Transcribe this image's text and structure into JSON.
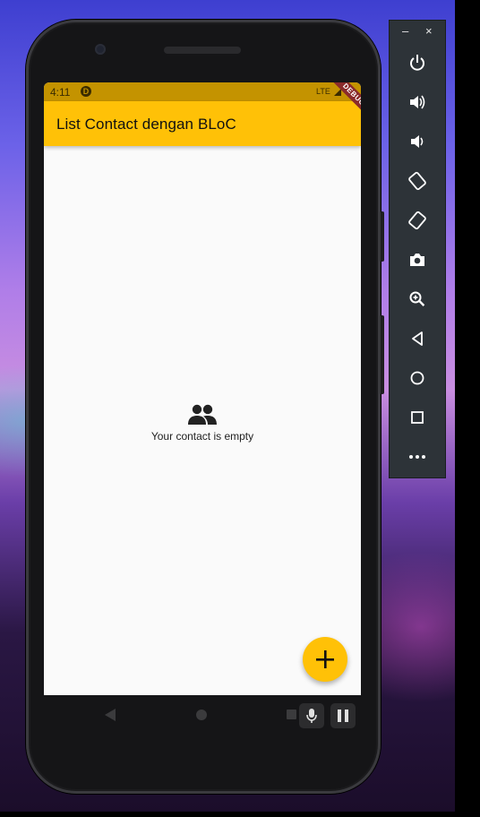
{
  "status_bar": {
    "time": "4:11",
    "app_icon_letter": "D",
    "network": "LTE"
  },
  "app_bar": {
    "title": "List Contact dengan BLoC",
    "color": "#ffc107"
  },
  "debug_banner": "DEBUG",
  "empty_state": {
    "icon": "people-icon",
    "text": "Your contact is empty"
  },
  "fab": {
    "icon": "add-icon",
    "color": "#ffc107"
  },
  "nav_bar": {
    "items": [
      "back-icon",
      "home-icon",
      "recents-icon"
    ]
  },
  "overlay_controls": [
    "microphone-icon",
    "pause-icon"
  ],
  "emulator_toolbar": {
    "window_controls": [
      "–",
      "×"
    ],
    "buttons": [
      {
        "name": "power-button",
        "icon": "power-icon"
      },
      {
        "name": "volume-up-button",
        "icon": "volume-up-icon"
      },
      {
        "name": "volume-down-button",
        "icon": "volume-down-icon"
      },
      {
        "name": "rotate-left-button",
        "icon": "rotate-left-icon"
      },
      {
        "name": "rotate-right-button",
        "icon": "rotate-right-icon"
      },
      {
        "name": "screenshot-button",
        "icon": "camera-icon"
      },
      {
        "name": "zoom-button",
        "icon": "zoom-icon"
      },
      {
        "name": "back-button",
        "icon": "back-icon"
      },
      {
        "name": "home-button",
        "icon": "home-icon"
      },
      {
        "name": "overview-button",
        "icon": "overview-icon"
      },
      {
        "name": "more-button",
        "icon": "more-icon"
      }
    ]
  }
}
